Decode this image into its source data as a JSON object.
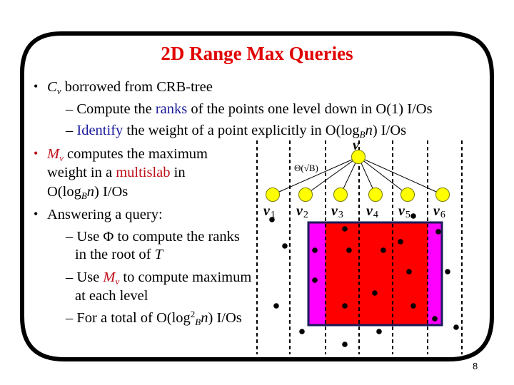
{
  "slide": {
    "title": "2D Range Max Queries",
    "page_number": "8",
    "bullets": [
      {
        "id": "cv",
        "parts": {
          "sym": "C",
          "sym_sub": "v",
          "text": " borrowed from CRB-tree"
        },
        "subitems": [
          {
            "dash": "–",
            "pre": " Compute the ",
            "highlight": "ranks",
            "post": " of the points one level down in O(1) I/Os"
          },
          {
            "dash": "–",
            "highlight": " Identify",
            "pre2": " the weight of a point explicitly in O(log",
            "sub": "B",
            "var": "n",
            "post": ") I/Os"
          }
        ]
      },
      {
        "id": "mv",
        "line1": {
          "sym": "M",
          "sym_sub": "v",
          "text": " computes the maximum"
        },
        "line2": {
          "pre": "weight in a ",
          "highlight": "multislab",
          "post": " in"
        },
        "line3": {
          "pre": "O(log",
          "sub": "B",
          "var": "n",
          "post": ") I/Os"
        }
      },
      {
        "id": "query",
        "text": "Answering a query:",
        "subitems": [
          {
            "dash": "–",
            "line1": {
              "pre": " Use ",
              "sym": "Φ",
              "post": " to compute the ranks"
            },
            "line2": {
              "pre": "in the root of ",
              "var": "T"
            }
          },
          {
            "dash": "–",
            "line1": {
              "pre": " Use ",
              "sym": "M",
              "sym_sub": "v",
              "post": " to compute maximum"
            },
            "line2": {
              "pre": "at each level"
            }
          },
          {
            "dash": "–",
            "line1": {
              "pre": " For a total of O(log",
              "sup": "2",
              "sub": "B",
              "var": "n",
              "post": ") I/Os"
            }
          }
        ]
      }
    ],
    "bullet_char": "•"
  },
  "diagram": {
    "root": {
      "label": "v"
    },
    "children": [
      {
        "label": "v",
        "sub": "1"
      },
      {
        "label": "v",
        "sub": "2"
      },
      {
        "label": "v",
        "sub": "3"
      },
      {
        "label": "v",
        "sub": "4"
      },
      {
        "label": "v",
        "sub": "5"
      },
      {
        "label": "v",
        "sub": "6"
      }
    ],
    "fanout_label": "Θ(√B)",
    "colors": {
      "node_fill": "#ffff00",
      "query_center": "#ff0000",
      "query_sides": "#ff00ff",
      "query_border": "#1a1a5a",
      "title": "#e00000",
      "highlight_blue": "#1a1a9c",
      "highlight_red": "#c0101a"
    },
    "slab_count": 7
  }
}
